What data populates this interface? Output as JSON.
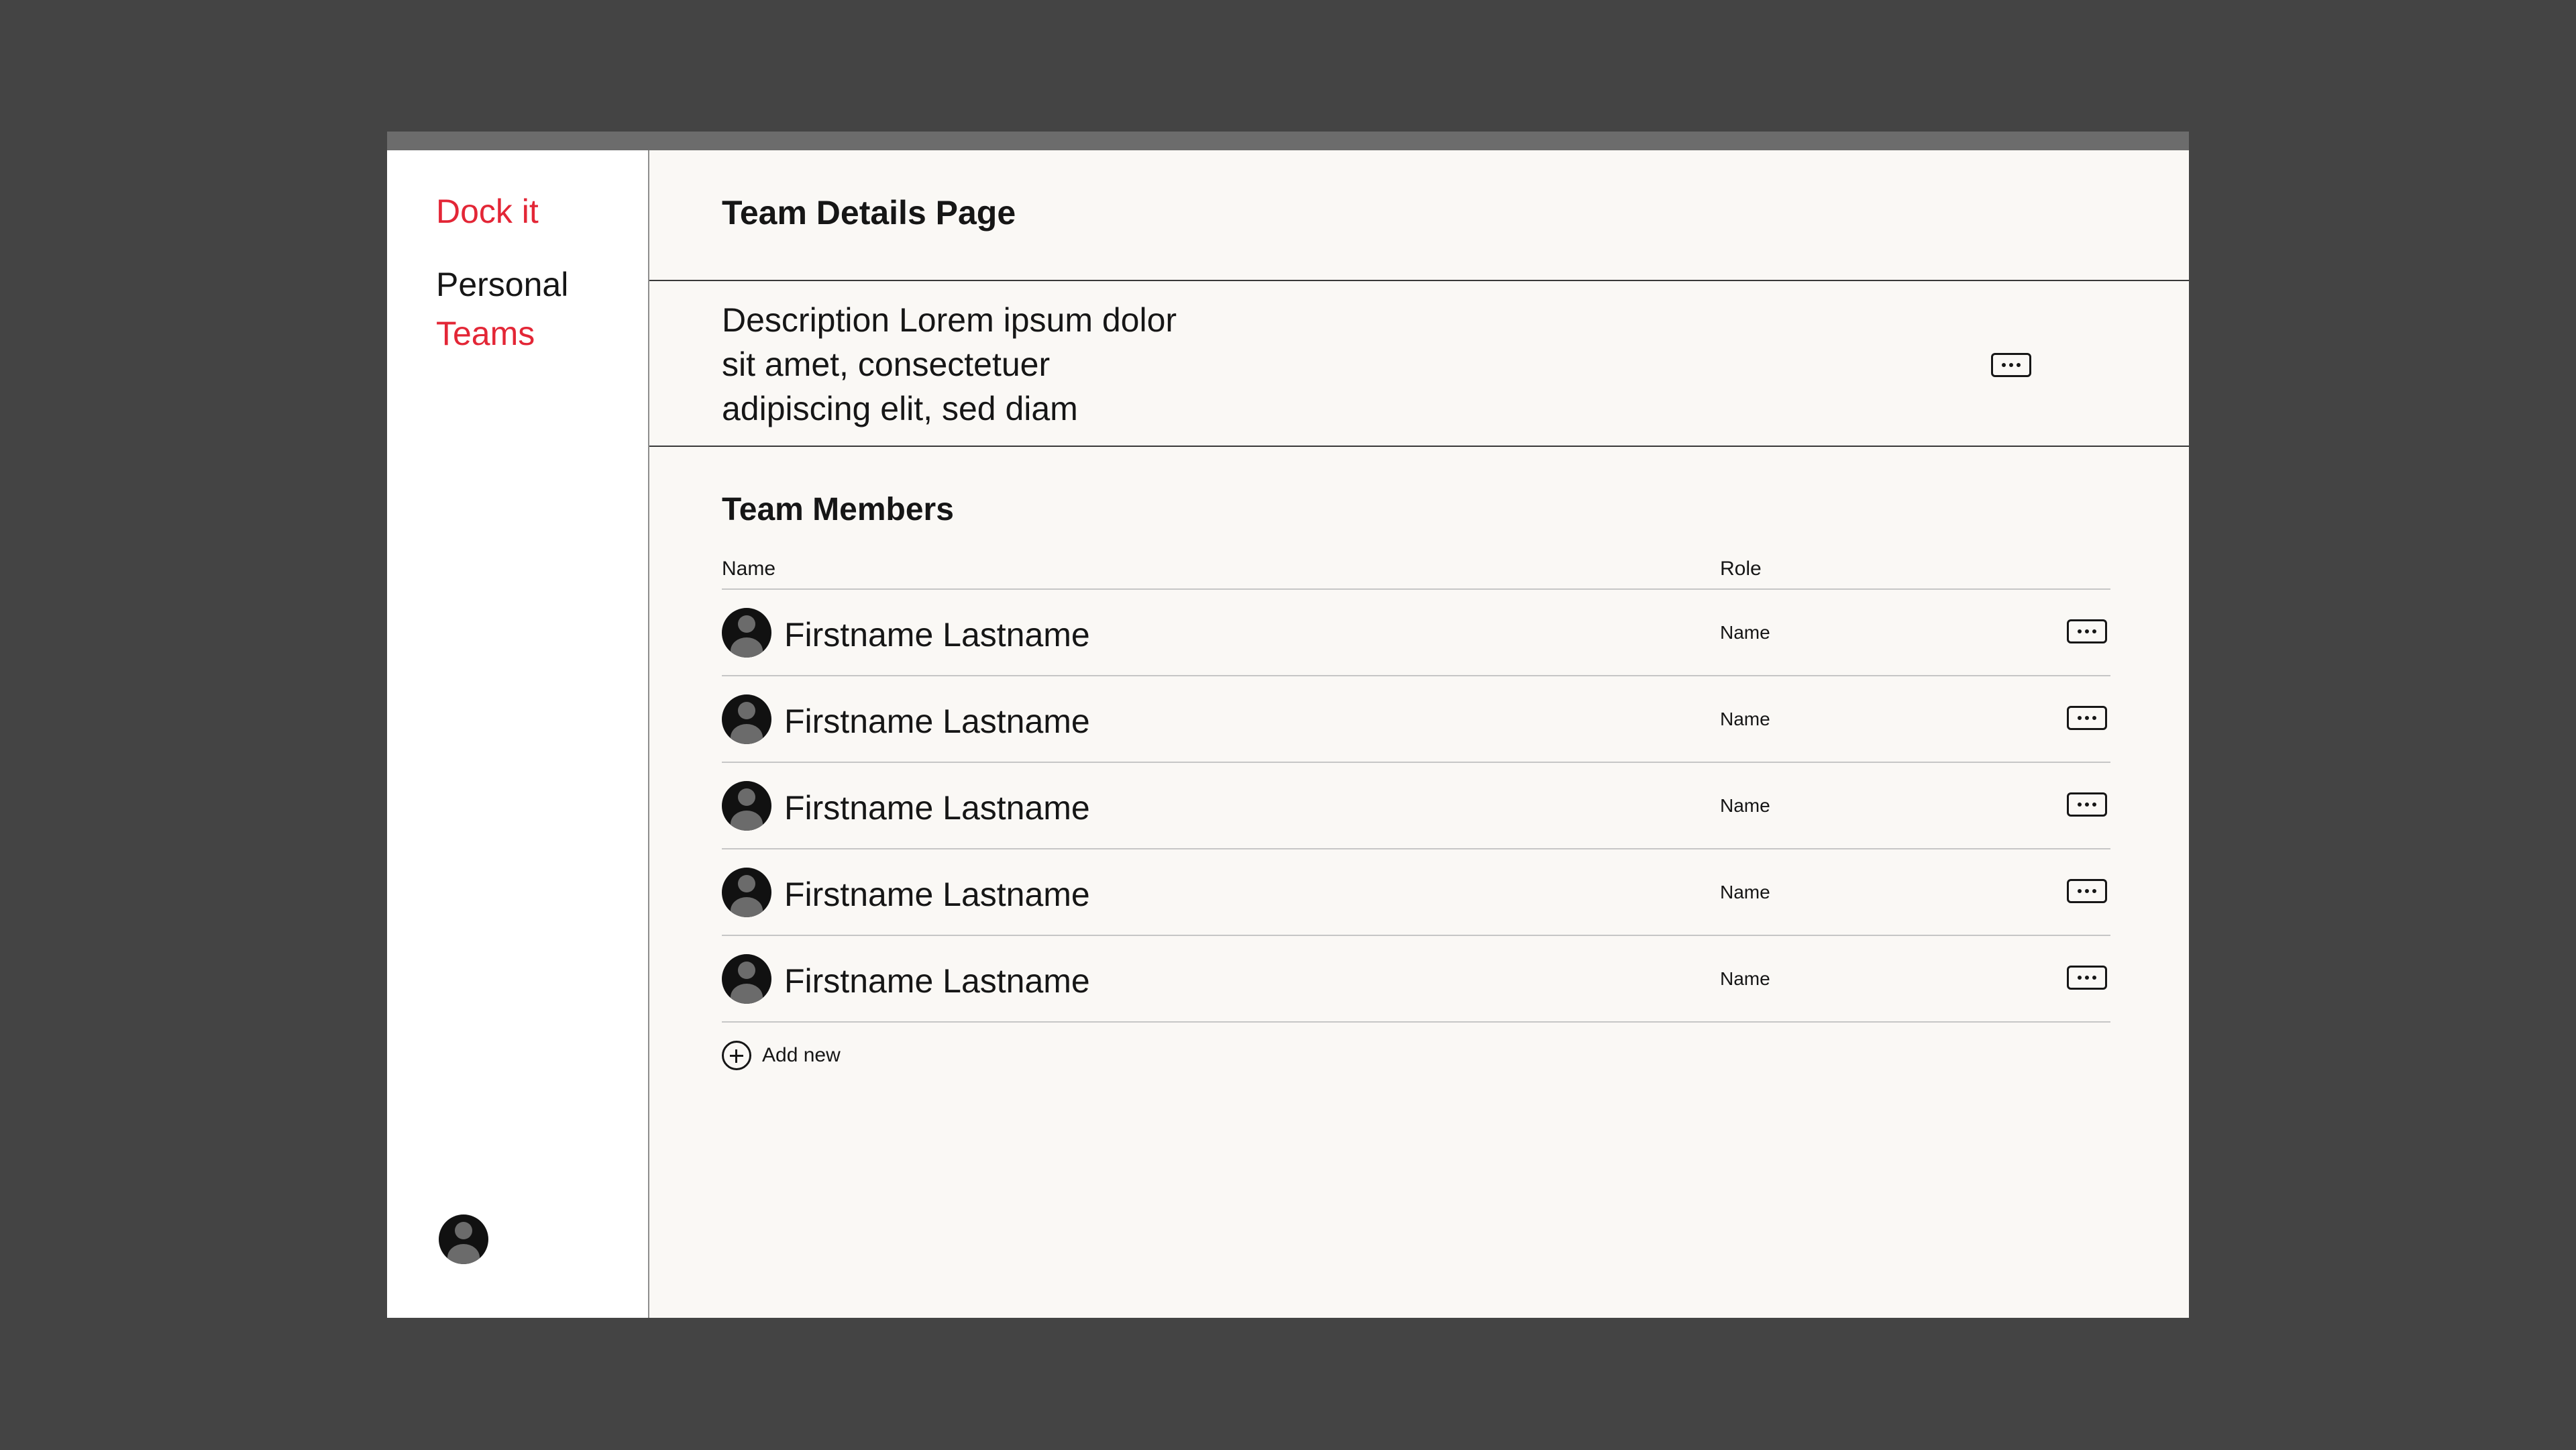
{
  "sidebar": {
    "brand": "Dock it",
    "nav": [
      {
        "label": "Personal",
        "active": false
      },
      {
        "label": "Teams",
        "active": true
      }
    ],
    "user_avatar_icon": "user-avatar-icon"
  },
  "main": {
    "title": "Team Details Page",
    "description": "Description Lorem ipsum dolor sit amet, consectetuer adipiscing elit, sed diam",
    "description_more_icon": "more-horizontal-icon",
    "members_section": {
      "title": "Team Members",
      "columns": [
        "Name",
        "Role"
      ],
      "rows": [
        {
          "name": "Firstname Lastname",
          "role": "Name"
        },
        {
          "name": "Firstname Lastname",
          "role": "Name"
        },
        {
          "name": "Firstname Lastname",
          "role": "Name"
        },
        {
          "name": "Firstname Lastname",
          "role": "Name"
        },
        {
          "name": "Firstname Lastname",
          "role": "Name"
        }
      ],
      "add_new_label": "Add new",
      "add_icon": "plus-circle-icon"
    }
  },
  "colors": {
    "background": "#444444",
    "window": "#faf8f5",
    "accent": "#e32636",
    "text": "#161616",
    "titlebar": "#6c6c6c"
  }
}
